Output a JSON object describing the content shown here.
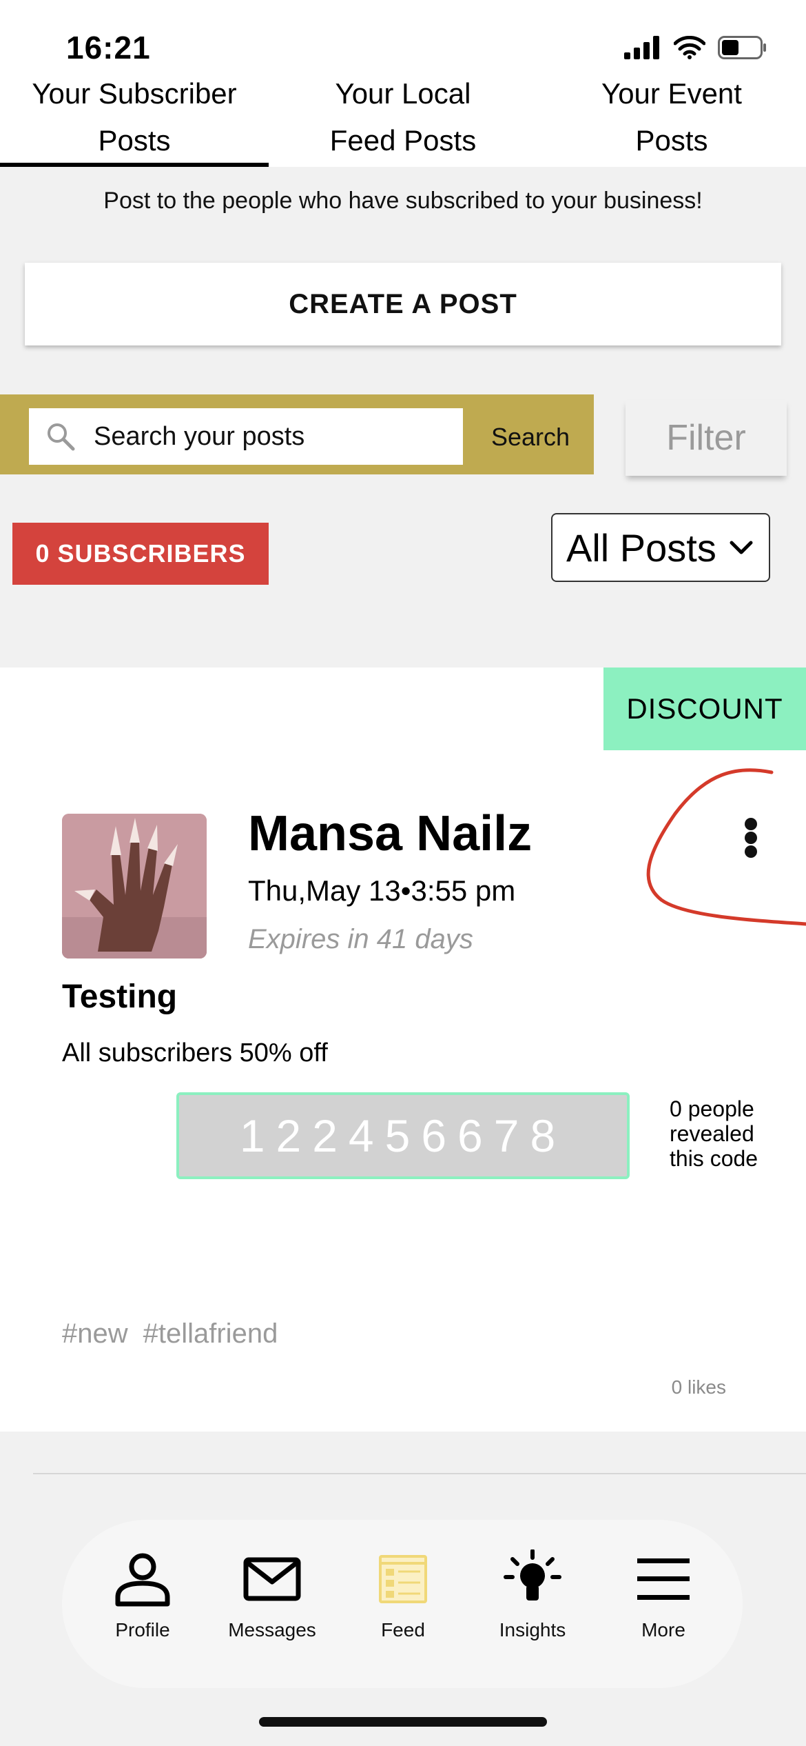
{
  "status_bar": {
    "time": "16:21"
  },
  "tabs": [
    {
      "line1": "Your Subscriber",
      "line2": "Posts",
      "active": true
    },
    {
      "line1": "Your Local",
      "line2": "Feed Posts",
      "active": false
    },
    {
      "line1": "Your Event",
      "line2": "Posts",
      "active": false
    }
  ],
  "info_text": "Post to the people who have subscribed to your business!",
  "create_button": "CREATE A POST",
  "search": {
    "placeholder": "Search your posts",
    "button": "Search"
  },
  "filter_button": "Filter",
  "subscribers_badge": "0 SUBSCRIBERS",
  "posts_select": {
    "selected": "All Posts"
  },
  "post": {
    "tag": "DISCOUNT",
    "business_name": "Mansa Nailz",
    "date": "Thu,May 13•3:55 pm",
    "expires": "Expires in 41 days",
    "title": "Testing",
    "body": "All subscribers 50% off",
    "code": "122456678",
    "reveal_count": "0 people revealed this code",
    "hashtags": [
      "#new",
      "#tellafriend"
    ],
    "likes": "0 likes"
  },
  "bottom_nav": [
    {
      "label": "Profile",
      "icon": "person-icon"
    },
    {
      "label": "Messages",
      "icon": "envelope-icon"
    },
    {
      "label": "Feed",
      "icon": "feed-icon",
      "active": true
    },
    {
      "label": "Insights",
      "icon": "lightbulb-icon"
    },
    {
      "label": "More",
      "icon": "hamburger-icon"
    }
  ],
  "colors": {
    "search_bar": "#bfaa50",
    "subscribers_badge": "#d4433d",
    "discount_tag": "#8cf0c0",
    "feed_icon": "#f0d878",
    "annotation": "#d43a2a"
  }
}
